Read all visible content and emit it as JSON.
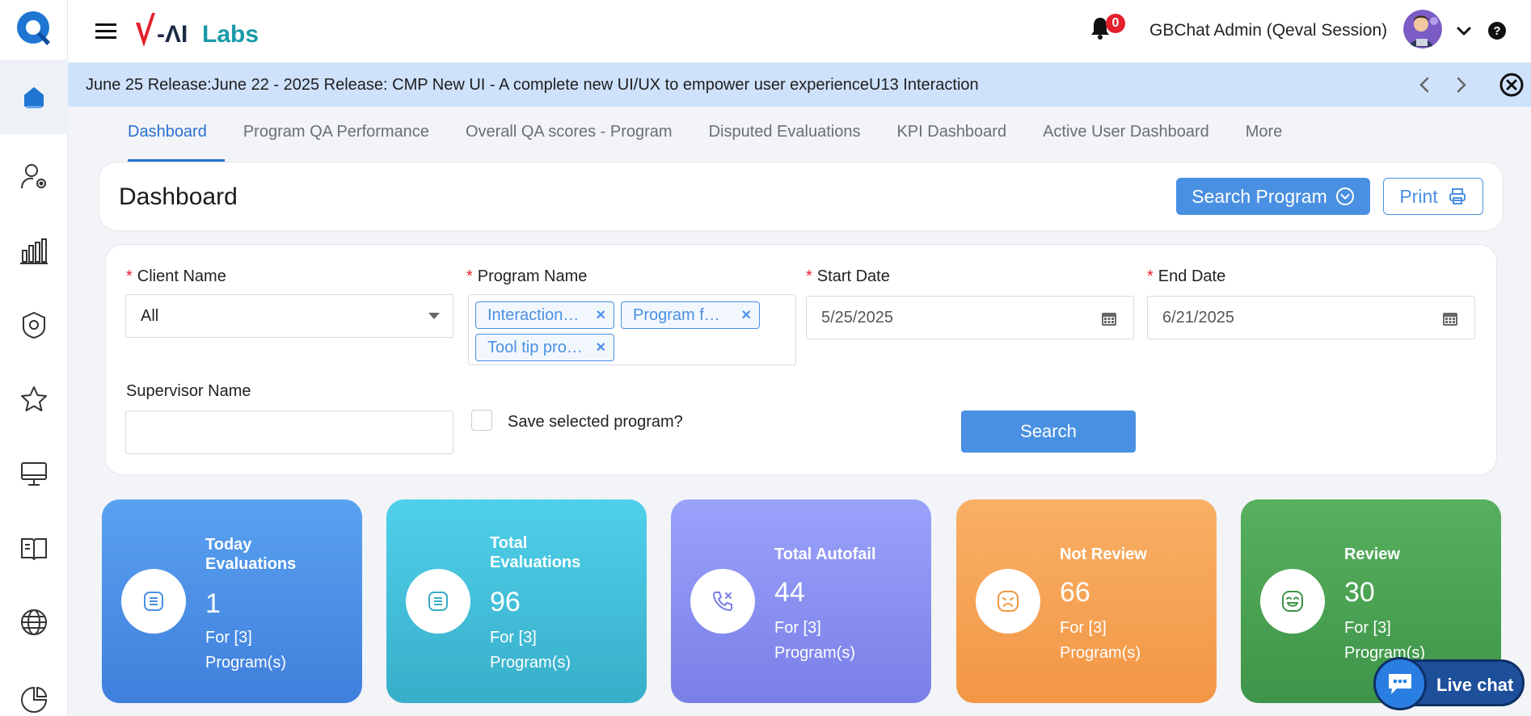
{
  "header": {
    "brand": "V-AI Labs",
    "notifications_count": "0",
    "user_name": "GBChat Admin (Qeval Session)"
  },
  "banner": {
    "text": "June 25 Release:June 22 - 2025 Release: CMP New UI - A complete new UI/UX to empower user experienceU13 Interaction"
  },
  "tabs": [
    {
      "label": "Dashboard",
      "active": true
    },
    {
      "label": "Program QA Performance"
    },
    {
      "label": "Overall QA scores - Program"
    },
    {
      "label": "Disputed Evaluations"
    },
    {
      "label": "KPI Dashboard"
    },
    {
      "label": "Active User Dashboard"
    },
    {
      "label": "More"
    }
  ],
  "title_card": {
    "title": "Dashboard",
    "search_program_label": "Search Program",
    "print_label": "Print"
  },
  "filters": {
    "required_mark": "*",
    "client_name_label": "Client Name",
    "client_name_value": "All",
    "program_name_label": "Program Name",
    "program_tags": [
      "Interaction…",
      "Program f…",
      "Tool tip pro…"
    ],
    "start_date_label": "Start Date",
    "start_date_value": "5/25/2025",
    "end_date_label": "End Date",
    "end_date_value": "6/21/2025",
    "supervisor_label": "Supervisor Name",
    "supervisor_value": "",
    "save_program_label": "Save selected program?",
    "search_label": "Search"
  },
  "stats": [
    {
      "title": "Today Evaluations",
      "value": "1",
      "sub": "For [3] Program(s)",
      "icon": "list-icon",
      "color": "#4a90e2"
    },
    {
      "title": "Total Evaluations",
      "value": "96",
      "sub": "For [3] Program(s)",
      "icon": "list-icon",
      "color": "#38aec9"
    },
    {
      "title": "Total Autofail",
      "value": "44",
      "sub": "For [3] Program(s)",
      "icon": "phone-missed-icon",
      "color": "#7a7fe6"
    },
    {
      "title": "Not Review",
      "value": "66",
      "sub": "For [3] Program(s)",
      "icon": "sad-face-icon",
      "color": "#f29645"
    },
    {
      "title": "Review",
      "value": "30",
      "sub": "For [3] Program(s)",
      "icon": "happy-face-icon",
      "color": "#3e9448"
    }
  ],
  "livechat": {
    "label": "Live chat"
  }
}
